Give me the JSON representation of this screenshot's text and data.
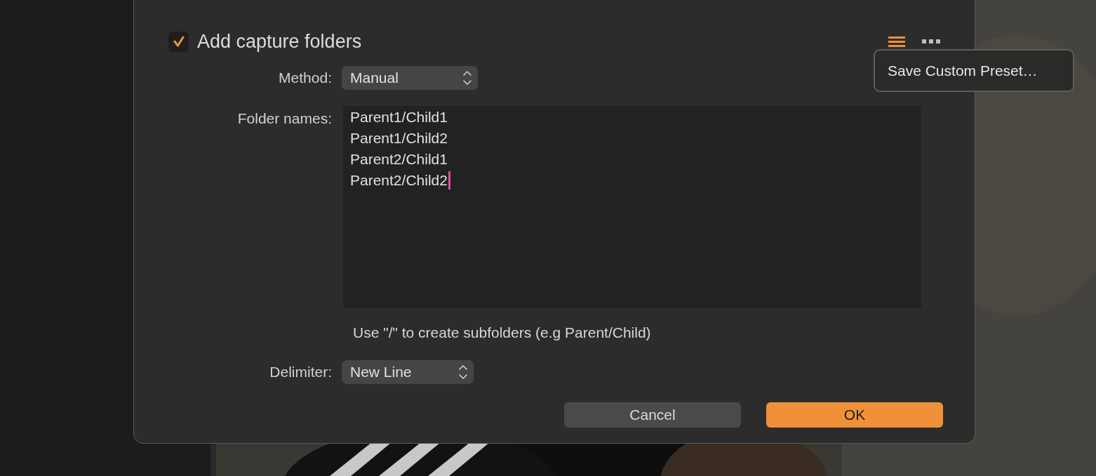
{
  "dialog": {
    "checkbox": {
      "label": "Add capture folders",
      "checked": true
    },
    "method": {
      "label": "Method:",
      "value": "Manual"
    },
    "folder_names": {
      "label": "Folder names:",
      "lines": [
        "Parent1/Child1",
        "Parent1/Child2",
        "Parent2/Child1",
        "Parent2/Child2"
      ],
      "focused": true
    },
    "hint": "Use \"/\" to create subfolders (e.g Parent/Child)",
    "delimiter": {
      "label": "Delimiter:",
      "value": "New Line"
    },
    "buttons": [
      {
        "label": "Cancel",
        "kind": "secondary"
      },
      {
        "label": "OK",
        "kind": "primary"
      }
    ]
  },
  "menu": {
    "items": [
      "Save Custom Preset…"
    ]
  }
}
